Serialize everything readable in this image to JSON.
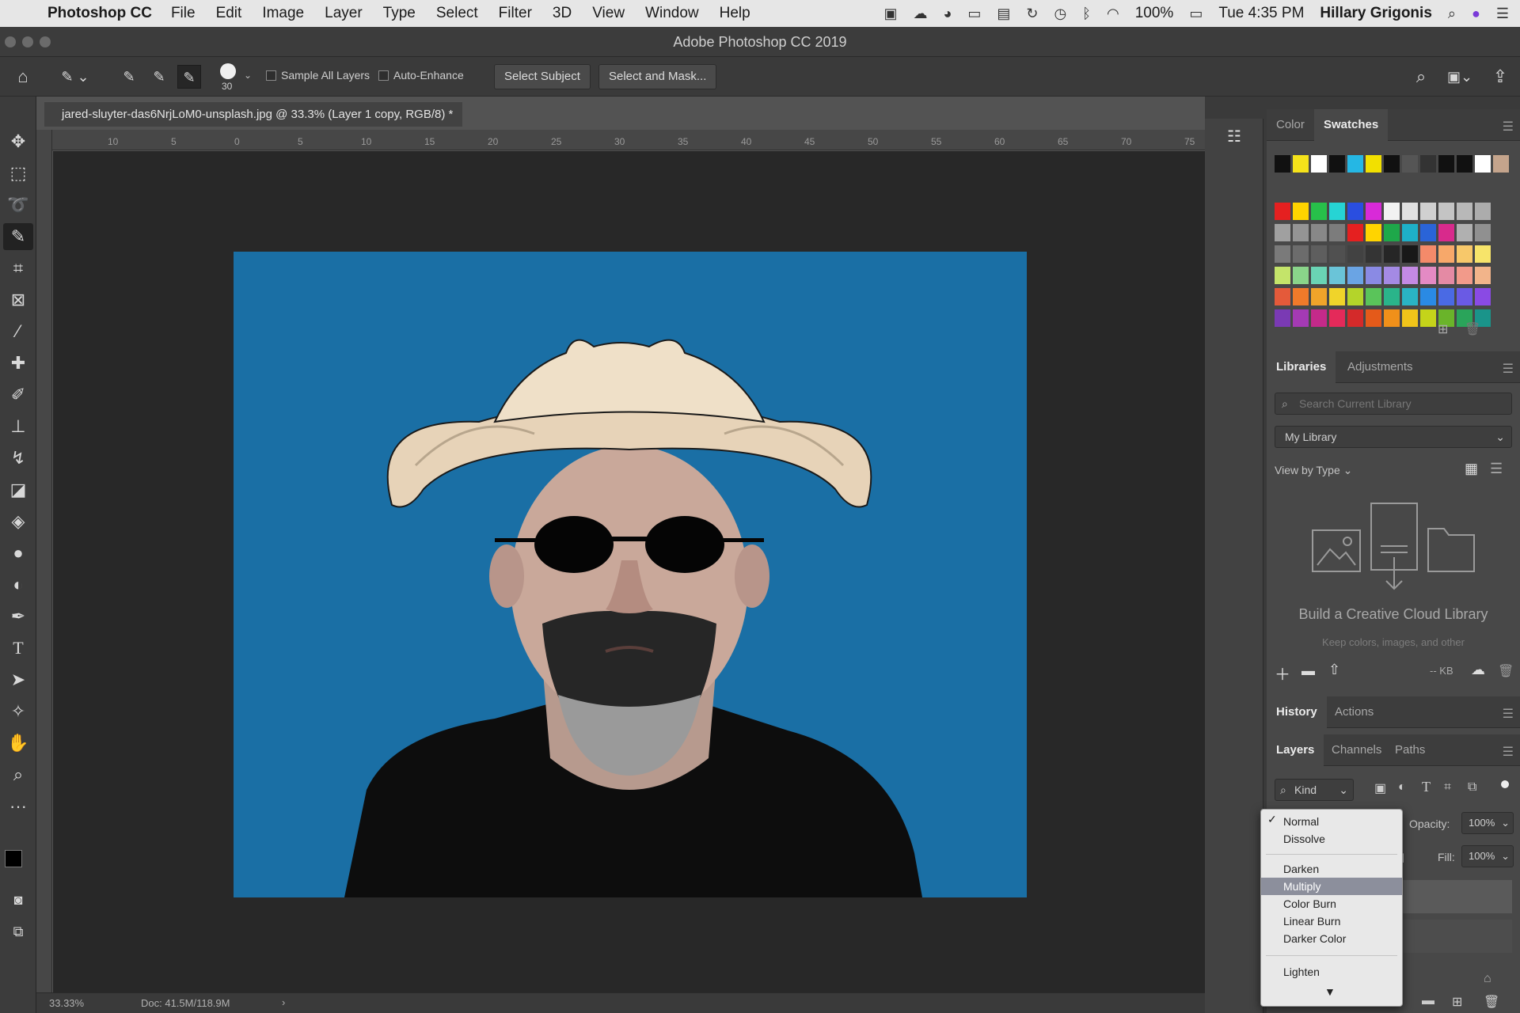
{
  "system_menubar": {
    "app_name": "Photoshop CC",
    "menus": [
      "File",
      "Edit",
      "Image",
      "Layer",
      "Type",
      "Select",
      "Filter",
      "3D",
      "View",
      "Window",
      "Help"
    ],
    "battery": "100%",
    "clock": "Tue 4:35 PM",
    "user": "Hillary Grigonis"
  },
  "window": {
    "title": "Adobe Photoshop CC 2019"
  },
  "options_bar": {
    "brush_size": "30",
    "sample_all_layers": "Sample All Layers",
    "auto_enhance": "Auto-Enhance",
    "select_subject": "Select Subject",
    "select_and_mask": "Select and Mask..."
  },
  "document": {
    "tab_title": "jared-sluyter-das6NrjLoM0-unsplash.jpg @ 33.3% (Layer 1 copy, RGB/8) *",
    "ruler_labels": [
      "10",
      "5",
      "0",
      "5",
      "10",
      "15",
      "20",
      "25",
      "30",
      "35",
      "40",
      "45",
      "50",
      "55",
      "60",
      "65",
      "70",
      "75"
    ]
  },
  "status_bar": {
    "zoom": "33.33%",
    "doc_size": "Doc: 41.5M/118.9M"
  },
  "swatches_panel": {
    "tabs": [
      "Color",
      "Swatches"
    ],
    "active_tab": "Swatches",
    "top_row": [
      "#111111",
      "#f5e21a",
      "#ffffff",
      "#111111",
      "#25b7e4",
      "#f2e000",
      "#111111",
      "#555555",
      "#333333",
      "#111111",
      "#111111",
      "#ffffff",
      "#c4a48c"
    ],
    "grid": [
      [
        "#e52020",
        "#ffd400",
        "#27c04a",
        "#26d4d4",
        "#2a4ee0",
        "#d82ad8",
        "#f2f2f2",
        "#e0e0e0",
        "#d0d0d0",
        "#c4c4c4",
        "#b8b8b8",
        "#acacac"
      ],
      [
        "#a0a0a0",
        "#949494",
        "#888888",
        "#7c7c7c",
        "#e52020",
        "#ffd400",
        "#1ea84a",
        "#1eb0c8",
        "#2a64d8",
        "#d82a8c",
        "#b0b0b0",
        "#909090"
      ],
      [
        "#7a7a7a",
        "#6c6c6c",
        "#5e5e5e",
        "#505050",
        "#424242",
        "#343434",
        "#262626",
        "#181818",
        "#f48a6a",
        "#f7a86a",
        "#f7c86a",
        "#f7e46a"
      ],
      [
        "#c4e46a",
        "#8ad48a",
        "#6ad4b4",
        "#6ac4d8",
        "#6aa4e4",
        "#8a8ae4",
        "#a48ae4",
        "#c48ae4",
        "#e48ac4",
        "#e48aa4",
        "#f29a8a",
        "#f2b48a"
      ],
      [
        "#e45a3a",
        "#f07a2a",
        "#f0a42a",
        "#f0d42a",
        "#b4d42a",
        "#5ac45a",
        "#2ab48a",
        "#2ab4c4",
        "#2a8ae4",
        "#4a6ae4",
        "#6a5ae4",
        "#8a4ae4"
      ],
      [
        "#7a3ab4",
        "#a43ab4",
        "#c42a8a",
        "#e42a5a",
        "#d42a2a",
        "#e45a1a",
        "#f0901a",
        "#f0c41a",
        "#c4d41a",
        "#6ab42a",
        "#2aa45a",
        "#1a948a"
      ]
    ]
  },
  "libraries_panel": {
    "tabs": [
      "Libraries",
      "Adjustments"
    ],
    "active_tab": "Libraries",
    "search_placeholder": "Search Current Library",
    "library": "My Library",
    "view_by": "View by Type",
    "build_title": "Build a Creative Cloud Library",
    "build_sub": "Keep colors, images, and other",
    "storage": "-- KB"
  },
  "history_panel": {
    "tabs": [
      "History",
      "Actions"
    ],
    "active_tab": "History"
  },
  "layers_panel": {
    "tabs": [
      "Layers",
      "Channels",
      "Paths"
    ],
    "active_tab": "Layers",
    "filter": "Kind",
    "opacity_label": "Opacity:",
    "opacity": "100%",
    "fill_label": "Fill:",
    "fill": "100%"
  },
  "blend_menu": {
    "checkmark": "✓",
    "items": [
      "Normal",
      "Dissolve",
      "Darken",
      "Multiply",
      "Color Burn",
      "Linear Burn",
      "Darker Color",
      "Lighten"
    ],
    "selected": "Normal",
    "highlighted": "Multiply"
  }
}
